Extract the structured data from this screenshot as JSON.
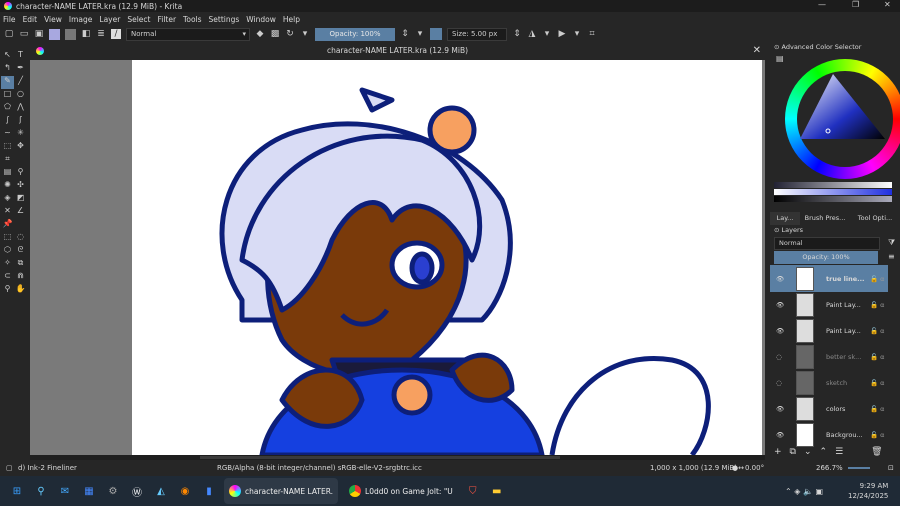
{
  "window": {
    "title": "character-NAME LATER.kra (12.9 MiB)  - Krita"
  },
  "menu": [
    "File",
    "Edit",
    "View",
    "Image",
    "Layer",
    "Select",
    "Filter",
    "Tools",
    "Settings",
    "Window",
    "Help"
  ],
  "toolbar": {
    "blend_mode": "Normal",
    "opacity": "Opacity: 100%",
    "size": "Size: 5.00 px"
  },
  "document": {
    "tab_title": "character-NAME LATER.kra (12.9 MiB)"
  },
  "dockers": {
    "color_selector_title": "Advanced Color Selector",
    "tabs": [
      "Lay...",
      "Brush Pres...",
      "Tool Opti..."
    ],
    "layers_title": "Layers",
    "layer_blend": "Normal",
    "layer_opacity": "Opacity:  100%",
    "layers": [
      {
        "name": "true line...",
        "visible": true,
        "selected": true
      },
      {
        "name": "Paint Lay...",
        "visible": true
      },
      {
        "name": "Paint Lay...",
        "visible": true
      },
      {
        "name": "better sk...",
        "visible": false
      },
      {
        "name": "sketch",
        "visible": false
      },
      {
        "name": "colors",
        "visible": true
      },
      {
        "name": "Backgrou...",
        "visible": true
      }
    ]
  },
  "status": {
    "brush": "d) Ink-2 Fineliner",
    "color_space": "RGB/Alpha (8-bit integer/channel)  sRGB-elle-V2-srgbtrc.icc",
    "image_size": "1,000 x 1,000 (12.9 MiB)",
    "rotation": "0.00°",
    "zoom": "266.7%"
  },
  "taskbar": {
    "apps": [
      {
        "label": "character-NAME LATER."
      },
      {
        "label": "L0dd0 on Game Jolt: \"U"
      }
    ],
    "time": "9:29 AM",
    "date": "12/24/2025"
  },
  "colors": {
    "accent": "#5a7fa3",
    "hair": "#d9dcf5",
    "outline": "#0d1f7a",
    "skin": "#7a3a0a",
    "orange": "#f7a060",
    "blue": "#1540e0"
  }
}
